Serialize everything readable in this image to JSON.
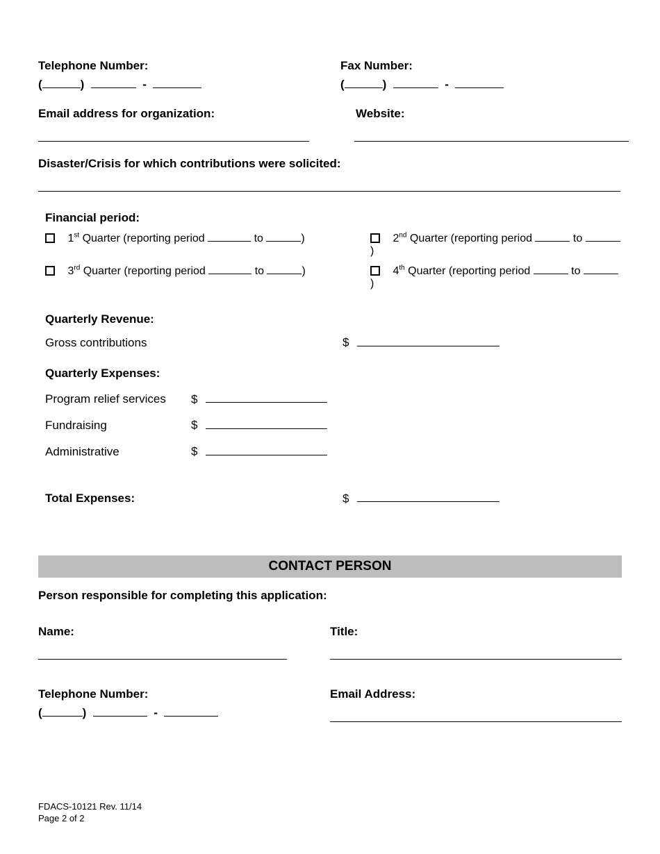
{
  "telephone": {
    "label": "Telephone Number:"
  },
  "fax": {
    "label": "Fax Number:"
  },
  "email_org": {
    "label": "Email address for organization:"
  },
  "website": {
    "label": "Website:"
  },
  "disaster": {
    "label": "Disaster/Crisis for which contributions were solicited:"
  },
  "financial_period": {
    "label": "Financial period:",
    "q1_pre": "1",
    "q1_sup": "st",
    "q1_text": " Quarter (reporting period ",
    "q2_pre": "2",
    "q2_sup": "nd",
    "q2_text": " Quarter (reporting period ",
    "q3_pre": "3",
    "q3_sup": "rd",
    "q3_text": " Quarter (reporting period ",
    "q4_pre": "4",
    "q4_sup": "th",
    "q4_text": "  Quarter (reporting period ",
    "to": " to ",
    "close": ")"
  },
  "revenue": {
    "heading": "Quarterly Revenue:",
    "gross_label": "Gross contributions",
    "dollar": "$"
  },
  "expenses": {
    "heading": "Quarterly Expenses:",
    "program_label": "Program relief services",
    "fundraising_label": "Fundraising",
    "admin_label": "Administrative",
    "dollar": "$",
    "total_label": "Total Expenses:"
  },
  "contact": {
    "banner": "CONTACT PERSON",
    "responsible": "Person responsible for completing this application:",
    "name": "Name:",
    "title": "Title:",
    "telephone": "Telephone Number:",
    "email": "Email Address:"
  },
  "footer": {
    "form": "FDACS-10121  Rev. 11/14",
    "page": "Page 2 of 2"
  },
  "paren_open": "(",
  "paren_close": ")",
  "dash": "-"
}
